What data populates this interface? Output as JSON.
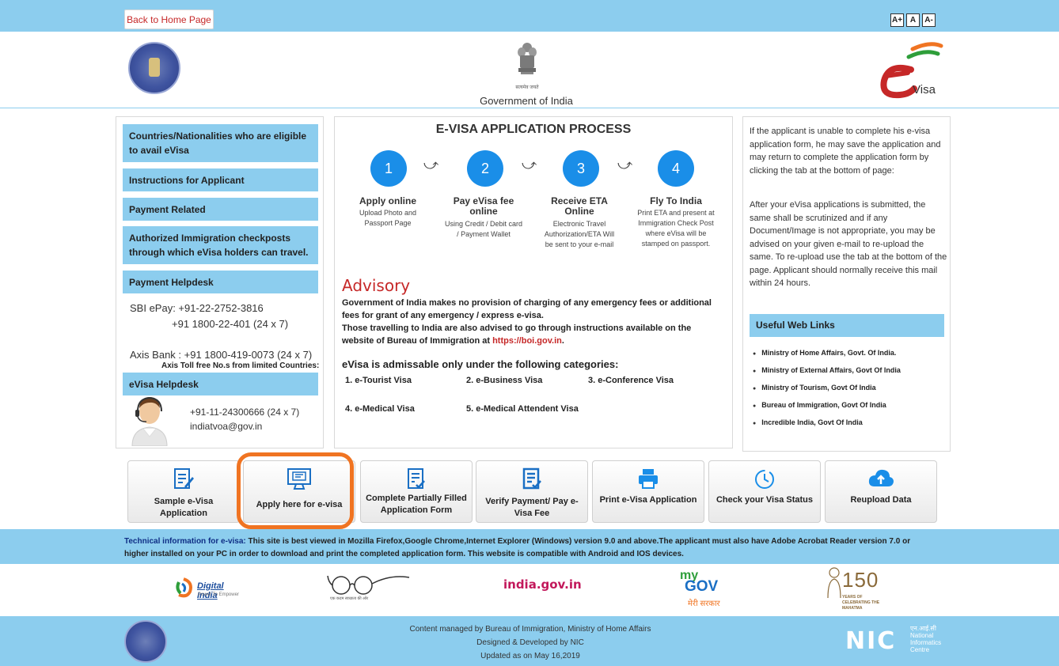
{
  "topbar": {
    "home_label": "Back to Home Page",
    "font_controls": [
      "A+",
      "A",
      "A-"
    ]
  },
  "header": {
    "government_label": "Government of India",
    "emblem_motto": "सत्यमेव जयते",
    "logo_text": "Visa"
  },
  "left_nav": {
    "items": [
      "Countries/Nationalities who are eligible to avail eVisa",
      "Instructions for Applicant",
      "Payment Related",
      "Authorized Immigration checkposts through which eVisa holders can travel.",
      "Payment Helpdesk",
      "eVisa Helpdesk"
    ],
    "sbi_label": "SBI ePay: +91-22-2752-3816",
    "sbi_alt": "+91 1800-22-401 (24 x 7)",
    "axis_label": "Axis Bank : +91 1800-419-0073 (24 x 7)",
    "axis_note": "Axis Toll free No.s from limited Countries:",
    "helpdesk_phone": "+91-11-24300666 (24 x 7)",
    "helpdesk_email": "indiatvoa@gov.in"
  },
  "process": {
    "title": "E-VISA APPLICATION PROCESS",
    "steps": [
      {
        "num": "1",
        "title": "Apply online",
        "desc": "Upload Photo and Passport Page"
      },
      {
        "num": "2",
        "title": "Pay eVisa fee online",
        "desc": "Using Credit / Debit card / Payment Wallet"
      },
      {
        "num": "3",
        "title": "Receive ETA Online",
        "desc": "Electronic Travel Authorization/ETA Will be sent to your e-mail"
      },
      {
        "num": "4",
        "title": "Fly To India",
        "desc": "Print ETA and present at Immigration Check Post where eVisa will be stamped on passport."
      }
    ]
  },
  "advisory": {
    "title": "Advisory",
    "line1": "Government of India makes no provision of charging of any emergency fees or additional fees for grant of any emergency / express e-visa.",
    "line2": "Those travelling to India are also advised to go through instructions available on the website of Bureau of Immigration at ",
    "link": "https://boi.gov.in",
    "line2_end": ".",
    "categories_title": "eVisa is admissable only under the following categories:",
    "categories": [
      "1.  e-Tourist Visa",
      "2.  e-Business Visa",
      "3.  e-Conference Visa",
      "4.  e-Medical Visa",
      "5.  e-Medical Attendent Visa"
    ]
  },
  "info": {
    "para1": "If the applicant is unable to complete his e-visa application form, he may save the application and may return to complete the application form by clicking the tab at the bottom of page:",
    "para2": "After your eVisa applications is submitted, the same shall be scrutinized and if any Document/Image is not appropriate, you may be advised on your given e-mail to re-upload the same. To re-upload use the tab at the bottom of the page. Applicant should normally receive this mail within 24 hours.",
    "links_title": "Useful Web Links",
    "links": [
      "Ministry of Home Affairs, Govt. Of India.",
      "Ministry of External Affairs, Govt Of India",
      "Ministry of Tourism, Govt Of India",
      "Bureau of Immigration, Govt Of India",
      "Incredible India, Govt Of India"
    ]
  },
  "actions": [
    "Sample e-Visa Application",
    "Apply here for e-visa",
    "Complete Partially Filled Application Form",
    "Verify Payment/ Pay e-Visa Fee",
    "Print e-Visa Application",
    "Check your Visa Status",
    "Reupload Data"
  ],
  "tech": {
    "lead": "Technical information for e-visa:",
    "body": " This site is best viewed in Mozilla Firefox,Google Chrome,Internet Explorer (Windows) version 9.0 and above.The applicant must also have Adobe Acrobat Reader version 7.0 or higher installed on your PC in order to download and print the completed application form. This website is compatible with Android and IOS devices."
  },
  "partners": {
    "digital_india": "Digital India",
    "digital_india_tag": "Power To Empower",
    "swachh_tag": "एक कदम स्वच्छता की ओर",
    "india_gov": "india.gov.in",
    "mygov_my": "my",
    "mygov_gov": "GOV",
    "mygov_hindi": "मेरी सरकार",
    "mahatma_num": "150",
    "mahatma_text": "YEARS OF CELEBRATING THE MAHATMA"
  },
  "footer": {
    "line1": "Content managed by Bureau of Immigration, Ministry of Home Affairs",
    "line2": "Designed & Developed by NIC",
    "line3": "Updated as on May 16,2019",
    "nic_hindi": "एन.आई.सी",
    "nic_line1": "National",
    "nic_line2": "Informatics",
    "nic_line3": "Centre"
  },
  "colors": {
    "bar": "#8ccdee",
    "step_blue": "#1a8ee8",
    "advisory_red": "#c62828",
    "highlight_orange": "#f07422"
  }
}
